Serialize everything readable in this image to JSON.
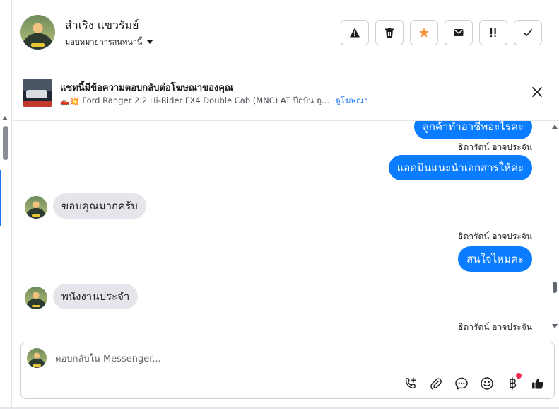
{
  "header": {
    "contact_name": "สำเริง แขวรัมย์",
    "assign_label": "มอบหมายการสนทนานี้"
  },
  "actions": [
    {
      "name": "spam-report",
      "icon": "warning-triangle-icon"
    },
    {
      "name": "delete",
      "icon": "trash-icon"
    },
    {
      "name": "star",
      "icon": "star-icon",
      "color": "#f5903d"
    },
    {
      "name": "mark-unread",
      "icon": "envelope-icon"
    },
    {
      "name": "follow-up",
      "icon": "exclamation-icon"
    },
    {
      "name": "mark-done",
      "icon": "checkmark-icon"
    }
  ],
  "ad_banner": {
    "title": "แชทนี้มีข้อความตอบกลับต่อโฆษณาของคุณ",
    "description": "Ford Ranger 2.2 Hi-Rider FX4 Double Cab (MNC) AT ปีกบิน ดุ...",
    "link": "ดูโฆษณา",
    "emoji": "🛻💥"
  },
  "messages": [
    {
      "dir": "out",
      "text": "ลูกค้าทำอาชีพอะไรคะ"
    },
    {
      "dir": "out",
      "sender": "ธิดารัตน์ อาจประจัน",
      "text": "แอดมินแนะนำเอกสารให้ค่ะ"
    },
    {
      "dir": "in",
      "text": "ขอบคุณมากครับ"
    },
    {
      "dir": "out",
      "sender": "ธิดารัตน์ อาจประจัน",
      "text": "สนใจไหมคะ"
    },
    {
      "dir": "in",
      "text": "พนังงานประจำ"
    },
    {
      "dir": "out",
      "sender": "ธิดารัตน์ อาจประจัน",
      "text": ""
    }
  ],
  "composer": {
    "placeholder": "ตอบกลับใน Messenger...",
    "tools": [
      "phone-add-icon",
      "paperclip-icon",
      "chat-bubble-icon",
      "smile-icon",
      "baht-icon",
      "thumbs-up-icon"
    ]
  },
  "colors": {
    "accent": "#0a7cff",
    "star": "#f5903d",
    "link": "#1877f2",
    "badge": "#f02849"
  }
}
